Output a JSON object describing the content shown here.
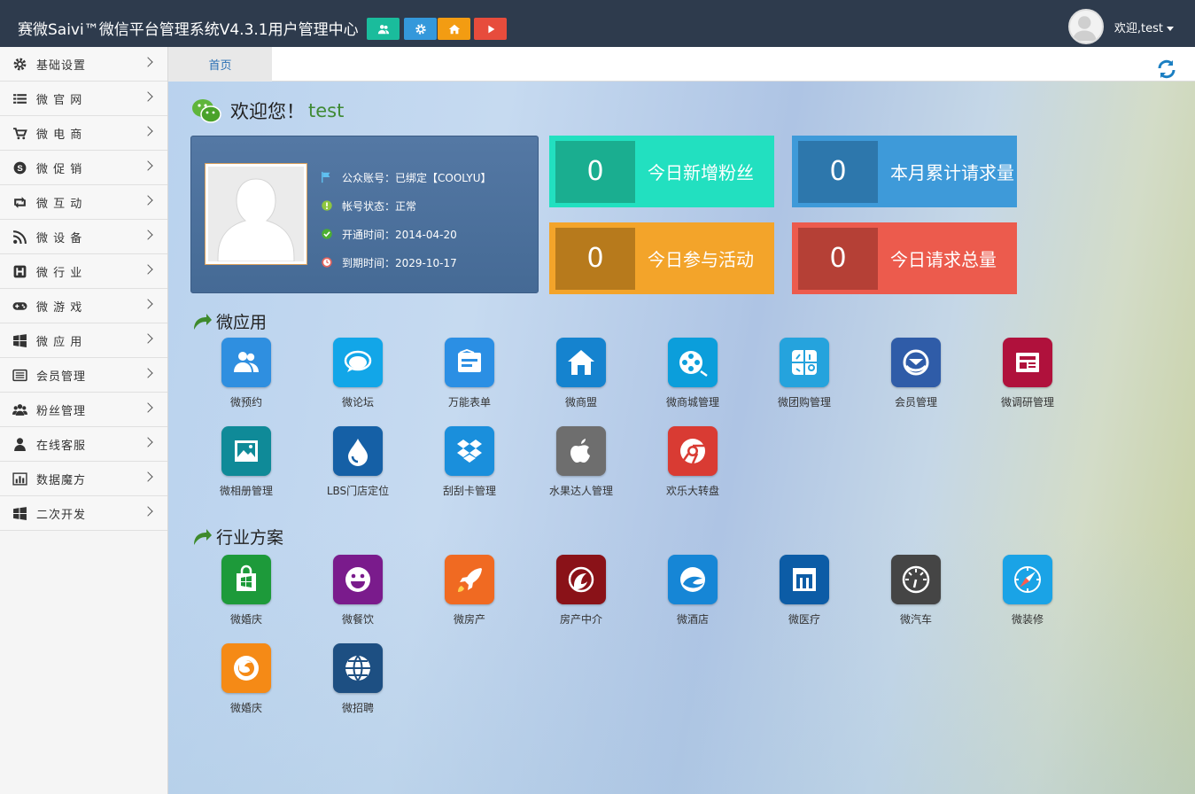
{
  "header": {
    "title": "赛微Saivi™微信平台管理系统V4.3.1用户管理中心",
    "buttons": [
      {
        "icon": "users-icon",
        "color": "#1abc9c"
      },
      {
        "icon": "gear-icon",
        "color": "#3498db"
      },
      {
        "icon": "home-icon",
        "color": "#f39c12"
      },
      {
        "icon": "play-icon",
        "color": "#e74c3c"
      }
    ],
    "user_label": "欢迎,test"
  },
  "sidebar": {
    "items": [
      {
        "label": "基础设置",
        "icon": "gear-icon"
      },
      {
        "label": "微 官 网",
        "icon": "list-icon"
      },
      {
        "label": "微 电 商",
        "icon": "cart-icon"
      },
      {
        "label": "微 促 销",
        "icon": "skype-icon"
      },
      {
        "label": "微 互 动",
        "icon": "retweet-icon"
      },
      {
        "label": "微 设 备",
        "icon": "rss-icon"
      },
      {
        "label": "微 行 业",
        "icon": "h-square-icon"
      },
      {
        "label": "微 游 戏",
        "icon": "gamepad-icon"
      },
      {
        "label": "微 应 用",
        "icon": "windows-icon"
      },
      {
        "label": "会员管理",
        "icon": "card-list-icon"
      },
      {
        "label": "粉丝管理",
        "icon": "group-icon"
      },
      {
        "label": "在线客服",
        "icon": "user-icon"
      },
      {
        "label": "数据魔方",
        "icon": "bar-chart-icon"
      },
      {
        "label": "二次开发",
        "icon": "windows-icon"
      }
    ]
  },
  "tabs": {
    "home": "首页"
  },
  "welcome": {
    "prefix": "欢迎您！",
    "username": "test"
  },
  "profile": {
    "rows": [
      {
        "text": "公众账号：已绑定【COOLYU】",
        "icon": "flag-icon"
      },
      {
        "text": "帐号状态：正常",
        "icon": "exclamation-icon"
      },
      {
        "text": "开通时间：2014-04-20",
        "icon": "check-icon"
      },
      {
        "text": "到期时间：2029-10-17",
        "icon": "clock-icon"
      }
    ]
  },
  "stats": [
    {
      "value": "0",
      "label": "今日新增粉丝",
      "bg": "#22e0c0",
      "num_bg": "#1aae90"
    },
    {
      "value": "0",
      "label": "本月累计请求量",
      "bg": "#3e9ad9",
      "num_bg": "#2d77ac"
    },
    {
      "value": "0",
      "label": "今日参与活动",
      "bg": "#f3a42a",
      "num_bg": "#b77a1c"
    },
    {
      "value": "0",
      "label": "今日请求总量",
      "bg": "#ec5b4d",
      "num_bg": "#b54036"
    }
  ],
  "sections": {
    "apps_title": "微应用",
    "industry_title": "行业方案"
  },
  "apps": [
    {
      "name": "微预约",
      "color": "#2f8fe0",
      "icon": "users-icon"
    },
    {
      "name": "微论坛",
      "color": "#12a6e8",
      "icon": "chat-bubbles-icon"
    },
    {
      "name": "万能表单",
      "color": "#2b8fe4",
      "icon": "form-icon"
    },
    {
      "name": "微商盟",
      "color": "#1583cf",
      "icon": "house-icon"
    },
    {
      "name": "微商城管理",
      "color": "#0b9edb",
      "icon": "film-reel-icon"
    },
    {
      "name": "微团购管理",
      "color": "#25a3dd",
      "icon": "grid-tools-icon"
    },
    {
      "name": "会员管理",
      "color": "#2f5ca8",
      "icon": "thunderbird-icon"
    },
    {
      "name": "微调研管理",
      "color": "#b0113c",
      "icon": "newspaper-icon"
    },
    {
      "name": "微相册管理",
      "color": "#0f8a98",
      "icon": "picture-icon"
    },
    {
      "name": "LBS门店定位",
      "color": "#1560a6",
      "icon": "drop-icon"
    },
    {
      "name": "刮刮卡管理",
      "color": "#1a8fdc",
      "icon": "dropbox-icon"
    },
    {
      "name": "水果达人管理",
      "color": "#6e6e6e",
      "icon": "apple-icon"
    },
    {
      "name": "欢乐大转盘",
      "color": "#d93b33",
      "icon": "chrome-icon"
    }
  ],
  "industry": [
    {
      "name": "微婚庆",
      "color": "#1d9a3a",
      "icon": "shopping-bag-icon"
    },
    {
      "name": "微餐饮",
      "color": "#7a1b8c",
      "icon": "smiley-icon"
    },
    {
      "name": "微房产",
      "color": "#f06a22",
      "icon": "rocket-icon"
    },
    {
      "name": "房产中介",
      "color": "#8a1218",
      "icon": "swirl-icon"
    },
    {
      "name": "微酒店",
      "color": "#1686d6",
      "icon": "cloud-circle-icon"
    },
    {
      "name": "微医疗",
      "color": "#0c5ca6",
      "icon": "maxthon-icon"
    },
    {
      "name": "微汽车",
      "color": "#454545",
      "icon": "gauge-icon"
    },
    {
      "name": "微装修",
      "color": "#1aa3e6",
      "icon": "compass-icon"
    },
    {
      "name": "微婚庆",
      "color": "#f58a16",
      "icon": "firefox-icon"
    },
    {
      "name": "微招聘",
      "color": "#1d4f82",
      "icon": "globe-icon"
    }
  ]
}
